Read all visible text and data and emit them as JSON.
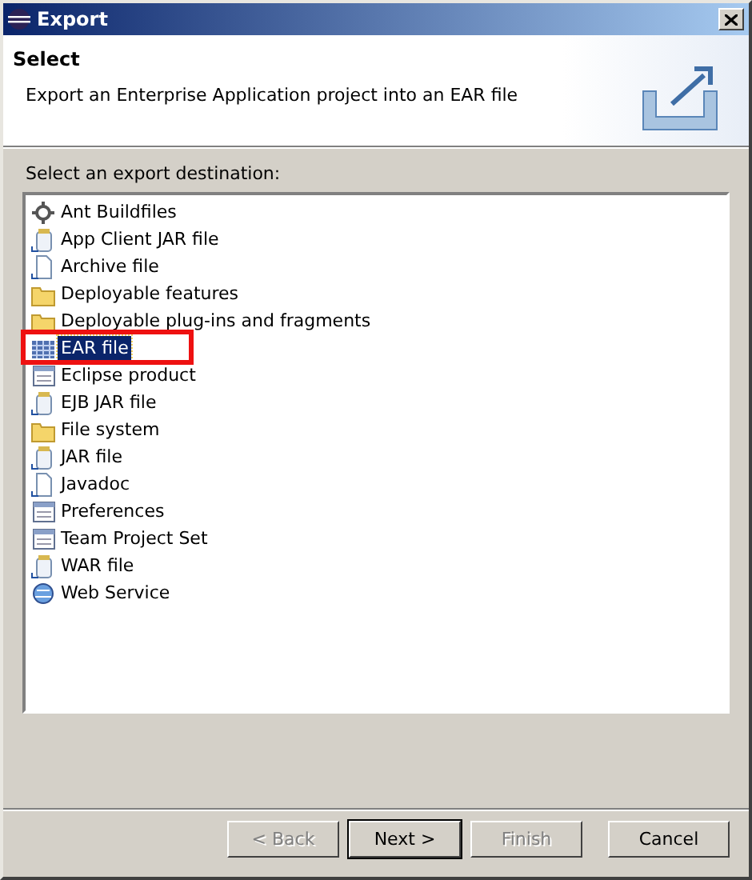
{
  "window": {
    "title": "Export"
  },
  "header": {
    "title": "Select",
    "description": "Export an Enterprise Application project into an EAR file"
  },
  "list_label": "Select an export destination:",
  "items": [
    {
      "label": "Ant Buildfiles",
      "selected": false
    },
    {
      "label": "App Client JAR file",
      "selected": false
    },
    {
      "label": "Archive file",
      "selected": false
    },
    {
      "label": "Deployable features",
      "selected": false
    },
    {
      "label": "Deployable plug-ins and fragments",
      "selected": false
    },
    {
      "label": "EAR file",
      "selected": true
    },
    {
      "label": "Eclipse product",
      "selected": false
    },
    {
      "label": "EJB JAR file",
      "selected": false
    },
    {
      "label": "File system",
      "selected": false
    },
    {
      "label": "JAR file",
      "selected": false
    },
    {
      "label": "Javadoc",
      "selected": false
    },
    {
      "label": "Preferences",
      "selected": false
    },
    {
      "label": "Team Project Set",
      "selected": false
    },
    {
      "label": "WAR file",
      "selected": false
    },
    {
      "label": "Web Service",
      "selected": false
    }
  ],
  "buttons": [
    {
      "label": "< Back",
      "disabled": true,
      "default": false
    },
    {
      "label": "Next >",
      "disabled": false,
      "default": true
    },
    {
      "label": "Finish",
      "disabled": true,
      "default": false
    },
    {
      "label": "Cancel",
      "disabled": false,
      "default": false
    }
  ]
}
